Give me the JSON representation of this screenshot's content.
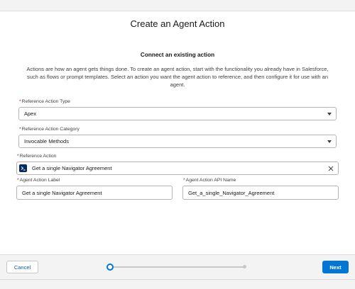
{
  "modal": {
    "title": "Create an Agent Action"
  },
  "section": {
    "title": "Connect an existing action",
    "intro": "Actions are how an agent gets things done. To create an agent action, start with the functionality you already have in Salesforce, such as flows or prompt templates. Select an action you want the agent action to reference, and then configure it for use with an agent."
  },
  "fields": {
    "reference_action_type": {
      "label": "Reference Action Type",
      "value": "Apex"
    },
    "reference_action_category": {
      "label": "Reference Action Category",
      "value": "Invocable Methods"
    },
    "reference_action": {
      "label": "Reference Action",
      "value": "Get a single Navigator Agreement",
      "icon": "apex-icon"
    },
    "agent_action_label": {
      "label": "Agent Action Label",
      "value": "Get a single Navigator Agreement"
    },
    "agent_action_api_name": {
      "label": "Agent Action API Name",
      "value": "Get_a_single_Navigator_Agreement"
    },
    "required_marker": "*"
  },
  "footer": {
    "cancel_label": "Cancel",
    "next_label": "Next",
    "progress": {
      "current_step": 1,
      "total_steps": 2
    }
  },
  "colors": {
    "brand": "#0176d3",
    "required": "#ba0517",
    "icon_bg": "#032d60"
  }
}
